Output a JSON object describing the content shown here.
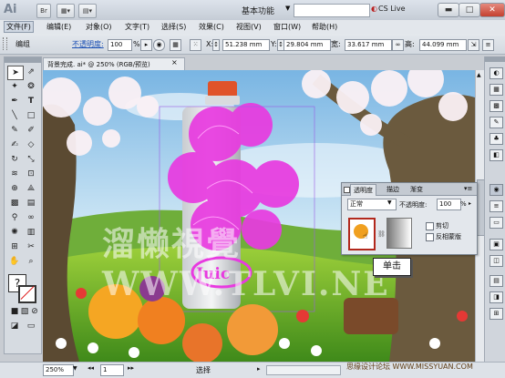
{
  "app": {
    "logo": "Ai",
    "bridge": "Br",
    "workspace": "基本功能",
    "cs_live": "CS Live"
  },
  "menu": [
    "文件(F)",
    "编辑(E)",
    "对象(O)",
    "文字(T)",
    "选择(S)",
    "效果(C)",
    "视图(V)",
    "窗口(W)",
    "帮助(H)"
  ],
  "control": {
    "mode": "编组",
    "opacity_label": "不透明度:",
    "opacity_value": "100",
    "opacity_unit": "%",
    "x_label": "X:",
    "x_value": "51.238 mm",
    "y_label": "Y:",
    "y_value": "29.804 mm",
    "w_label": "宽:",
    "w_value": "33.617 mm",
    "h_label": "高:",
    "h_value": "44.099 mm"
  },
  "document": {
    "tab": "背景完成. ai* @ 250% (RGB/预览)",
    "close": "×"
  },
  "status": {
    "zoom": "250%",
    "page": "1",
    "mode": "选择"
  },
  "panel": {
    "tabs": [
      "透明度",
      "描边",
      "渐变"
    ],
    "blend_mode": "正常",
    "opacity_label": "不透明度:",
    "opacity_value": "100",
    "opacity_unit": "%",
    "clip_label": "剪切",
    "invert_label": "反相蒙版"
  },
  "callout": "单击",
  "watermark": "溜懒視覺 WWW.TLVI.NE",
  "footer_watermark": "思缘设计论坛 WWW.MISSYUAN.COM",
  "colors": {
    "selection": "#e83ae0",
    "can_orange": "#e0532a",
    "close_red": "#c4402f",
    "thumb_border": "#b2281c"
  }
}
